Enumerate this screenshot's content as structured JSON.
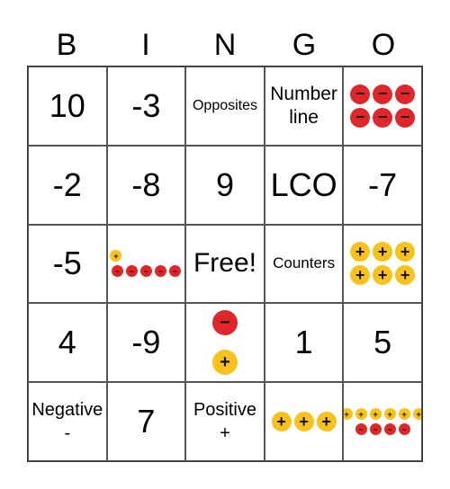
{
  "header": [
    "B",
    "I",
    "N",
    "G",
    "O"
  ],
  "colors": {
    "negative_counter": "#e0262b",
    "positive_counter": "#f8c21a"
  },
  "cells": [
    [
      {
        "text": "10",
        "style": "big"
      },
      {
        "text": "-3",
        "style": "big"
      },
      {
        "text": "Opposites",
        "style": "small"
      },
      {
        "text": "Number line",
        "style": "mid"
      },
      {
        "counters": [
          {
            "sign": "-",
            "count": 3
          },
          {
            "sign": "-",
            "count": 3
          }
        ],
        "size": "lg"
      }
    ],
    [
      {
        "text": "-2",
        "style": "big"
      },
      {
        "text": "-8",
        "style": "big"
      },
      {
        "text": "9",
        "style": "big"
      },
      {
        "text": "LCO",
        "style": "big"
      },
      {
        "text": "-7",
        "style": "big"
      }
    ],
    [
      {
        "text": "-5",
        "style": "big"
      },
      {
        "counters": [
          {
            "sign": "+",
            "count": 1
          },
          {
            "sign": "-",
            "count": 5
          }
        ],
        "size": "sm",
        "align": "left"
      },
      {
        "text": "Free!",
        "style": "big2"
      },
      {
        "text": "Counters",
        "style": "small2"
      },
      {
        "counters": [
          {
            "sign": "+",
            "count": 3
          },
          {
            "sign": "+",
            "count": 3
          }
        ],
        "size": "lg"
      }
    ],
    [
      {
        "text": "4",
        "style": "big"
      },
      {
        "text": "-9",
        "style": "big"
      },
      {
        "counters": [
          {
            "sign": "-",
            "count": 1
          },
          {
            "sign": "+",
            "count": 1
          }
        ],
        "size": "xl"
      },
      {
        "text": "1",
        "style": "big"
      },
      {
        "text": "5",
        "style": "big"
      }
    ],
    [
      {
        "lines": [
          "Negative",
          "-"
        ],
        "style": "txt"
      },
      {
        "text": "7",
        "style": "big"
      },
      {
        "lines": [
          "Positive",
          "+"
        ],
        "style": "txt"
      },
      {
        "counters": [
          {
            "sign": "+",
            "count": 3
          }
        ],
        "size": "lg"
      },
      {
        "counters": [
          {
            "sign": "+",
            "count": 6
          },
          {
            "sign": "-",
            "count": 4
          }
        ],
        "size": "sm"
      }
    ]
  ]
}
